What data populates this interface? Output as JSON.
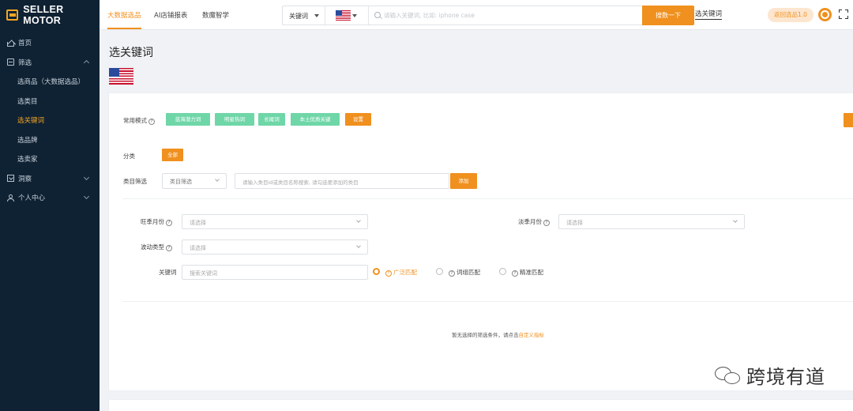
{
  "brand": {
    "name": "SELLER MOTOR",
    "accent": "#f0901e",
    "sidebar_bg": "#0f2233"
  },
  "sidebar": {
    "items": [
      {
        "label": "首页",
        "icon": "home-icon"
      },
      {
        "label": "筛选",
        "icon": "filter-icon",
        "expanded": true
      },
      {
        "label": "选商品（大数据选品）",
        "sub": true
      },
      {
        "label": "选类目",
        "sub": true
      },
      {
        "label": "选关键词",
        "sub": true,
        "active": true
      },
      {
        "label": "选品牌",
        "sub": true
      },
      {
        "label": "选卖家",
        "sub": true
      },
      {
        "label": "洞察",
        "icon": "insight-icon",
        "expanded": false
      },
      {
        "label": "个人中心",
        "icon": "user-icon",
        "expanded": false
      }
    ]
  },
  "topbar": {
    "tabs": [
      "大数据选品",
      "AI店铺报表",
      "数魔智学"
    ],
    "active_tab": "大数据选品",
    "search_type": "关键词",
    "search_placeholder": "请输入关键词, 比如: iphone case",
    "search_button": "搜数一下",
    "keyword_link": "选关键词",
    "back_button": "返回选品1.0"
  },
  "page": {
    "title": "选关键词",
    "marketplace_flag": "us-flag-icon"
  },
  "filters": {
    "mode_label": "常用模式",
    "modes": [
      "蓝海潜力词",
      "明星热词",
      "长尾词",
      "本土优质关键",
      "设置"
    ],
    "category_label": "分类",
    "category_all": "全部",
    "category_filter_label": "类目筛选",
    "category_select": "类目筛选",
    "category_input_placeholder": "请输入类目id或类目名称搜索, 请勾选要添加的类目",
    "add_button": "添加",
    "peak_month_label": "旺季月份",
    "peak_month_placeholder": "请选择",
    "off_month_label": "淡季月份",
    "off_month_placeholder": "请选择",
    "fluctuation_label": "波动类型",
    "fluctuation_placeholder": "请选择",
    "keyword_label": "关键词",
    "keyword_placeholder": "搜索关键词",
    "match_options": [
      {
        "label": "广泛匹配",
        "selected": true
      },
      {
        "label": "词组匹配",
        "selected": false
      },
      {
        "label": "精准匹配",
        "selected": false
      }
    ],
    "empty_message": "暂无选择的筛选条件，请点击",
    "empty_link": "自定义指标"
  },
  "watermark": {
    "text": "跨境有道"
  }
}
